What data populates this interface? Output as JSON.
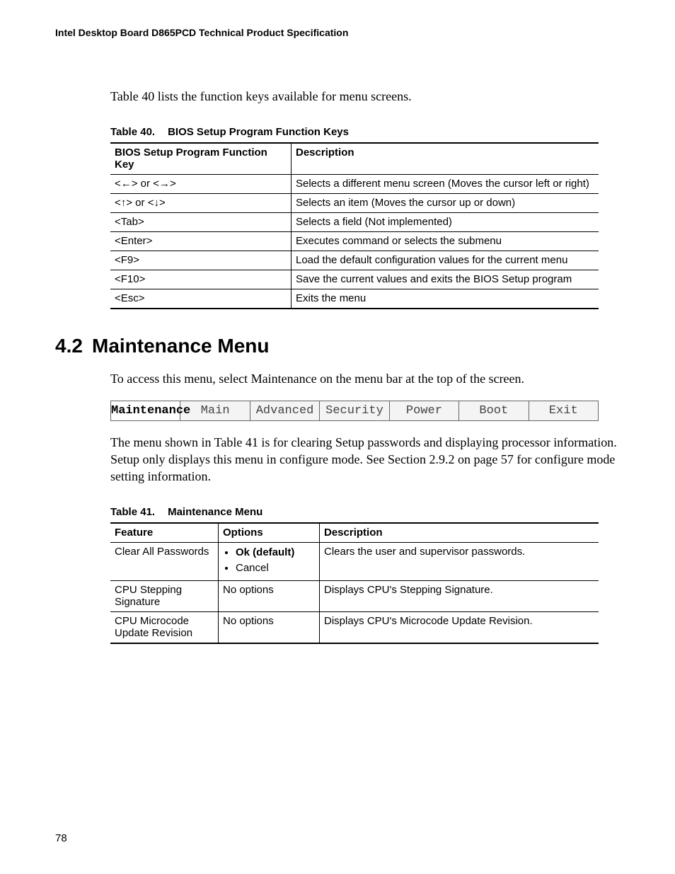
{
  "header": "Intel Desktop Board D865PCD Technical Product Specification",
  "intro40": "Table 40 lists the function keys available for menu screens.",
  "table40": {
    "caption_num": "Table 40.",
    "caption_title": "BIOS Setup Program Function Keys",
    "head_key": "BIOS Setup Program Function Key",
    "head_desc": "Description",
    "rows": [
      {
        "k": "<←> or <→>",
        "d": "Selects a different menu screen (Moves the cursor left or right)"
      },
      {
        "k": "<↑> or <↓>",
        "d": "Selects an item (Moves the cursor up or down)"
      },
      {
        "k": "<Tab>",
        "d": "Selects a field (Not implemented)"
      },
      {
        "k": "<Enter>",
        "d": "Executes command or selects the submenu"
      },
      {
        "k": "<F9>",
        "d": "Load the default configuration values for the current menu"
      },
      {
        "k": "<F10>",
        "d": "Save the current values and exits the BIOS Setup program"
      },
      {
        "k": "<Esc>",
        "d": "Exits the menu"
      }
    ]
  },
  "section": {
    "num": "4.2",
    "title": "Maintenance Menu",
    "access": "To access this menu, select Maintenance on the menu bar at the top of the screen.",
    "after_menubar": "The menu shown in Table 41 is for clearing Setup passwords and displaying processor information.  Setup only displays this menu in configure mode.  See Section 2.9.2 on page 57 for configure mode setting information."
  },
  "menubar": {
    "tabs": [
      "Maintenance",
      "Main",
      "Advanced",
      "Security",
      "Power",
      "Boot",
      "Exit"
    ],
    "active_index": 0
  },
  "table41": {
    "caption_num": "Table 41.",
    "caption_title": "Maintenance Menu",
    "head_feature": "Feature",
    "head_options": "Options",
    "head_desc": "Description",
    "rows": [
      {
        "feature": "Clear All Passwords",
        "options_mode": "list",
        "options": [
          "Ok (default)",
          "Cancel"
        ],
        "default_index": 0,
        "desc": "Clears the user and supervisor passwords."
      },
      {
        "feature": "CPU Stepping Signature",
        "options_mode": "text",
        "options_text": "No options",
        "desc": "Displays CPU's Stepping Signature."
      },
      {
        "feature": "CPU Microcode Update Revision",
        "options_mode": "text",
        "options_text": "No options",
        "desc": "Displays CPU's Microcode Update Revision."
      }
    ]
  },
  "page_number": "78"
}
